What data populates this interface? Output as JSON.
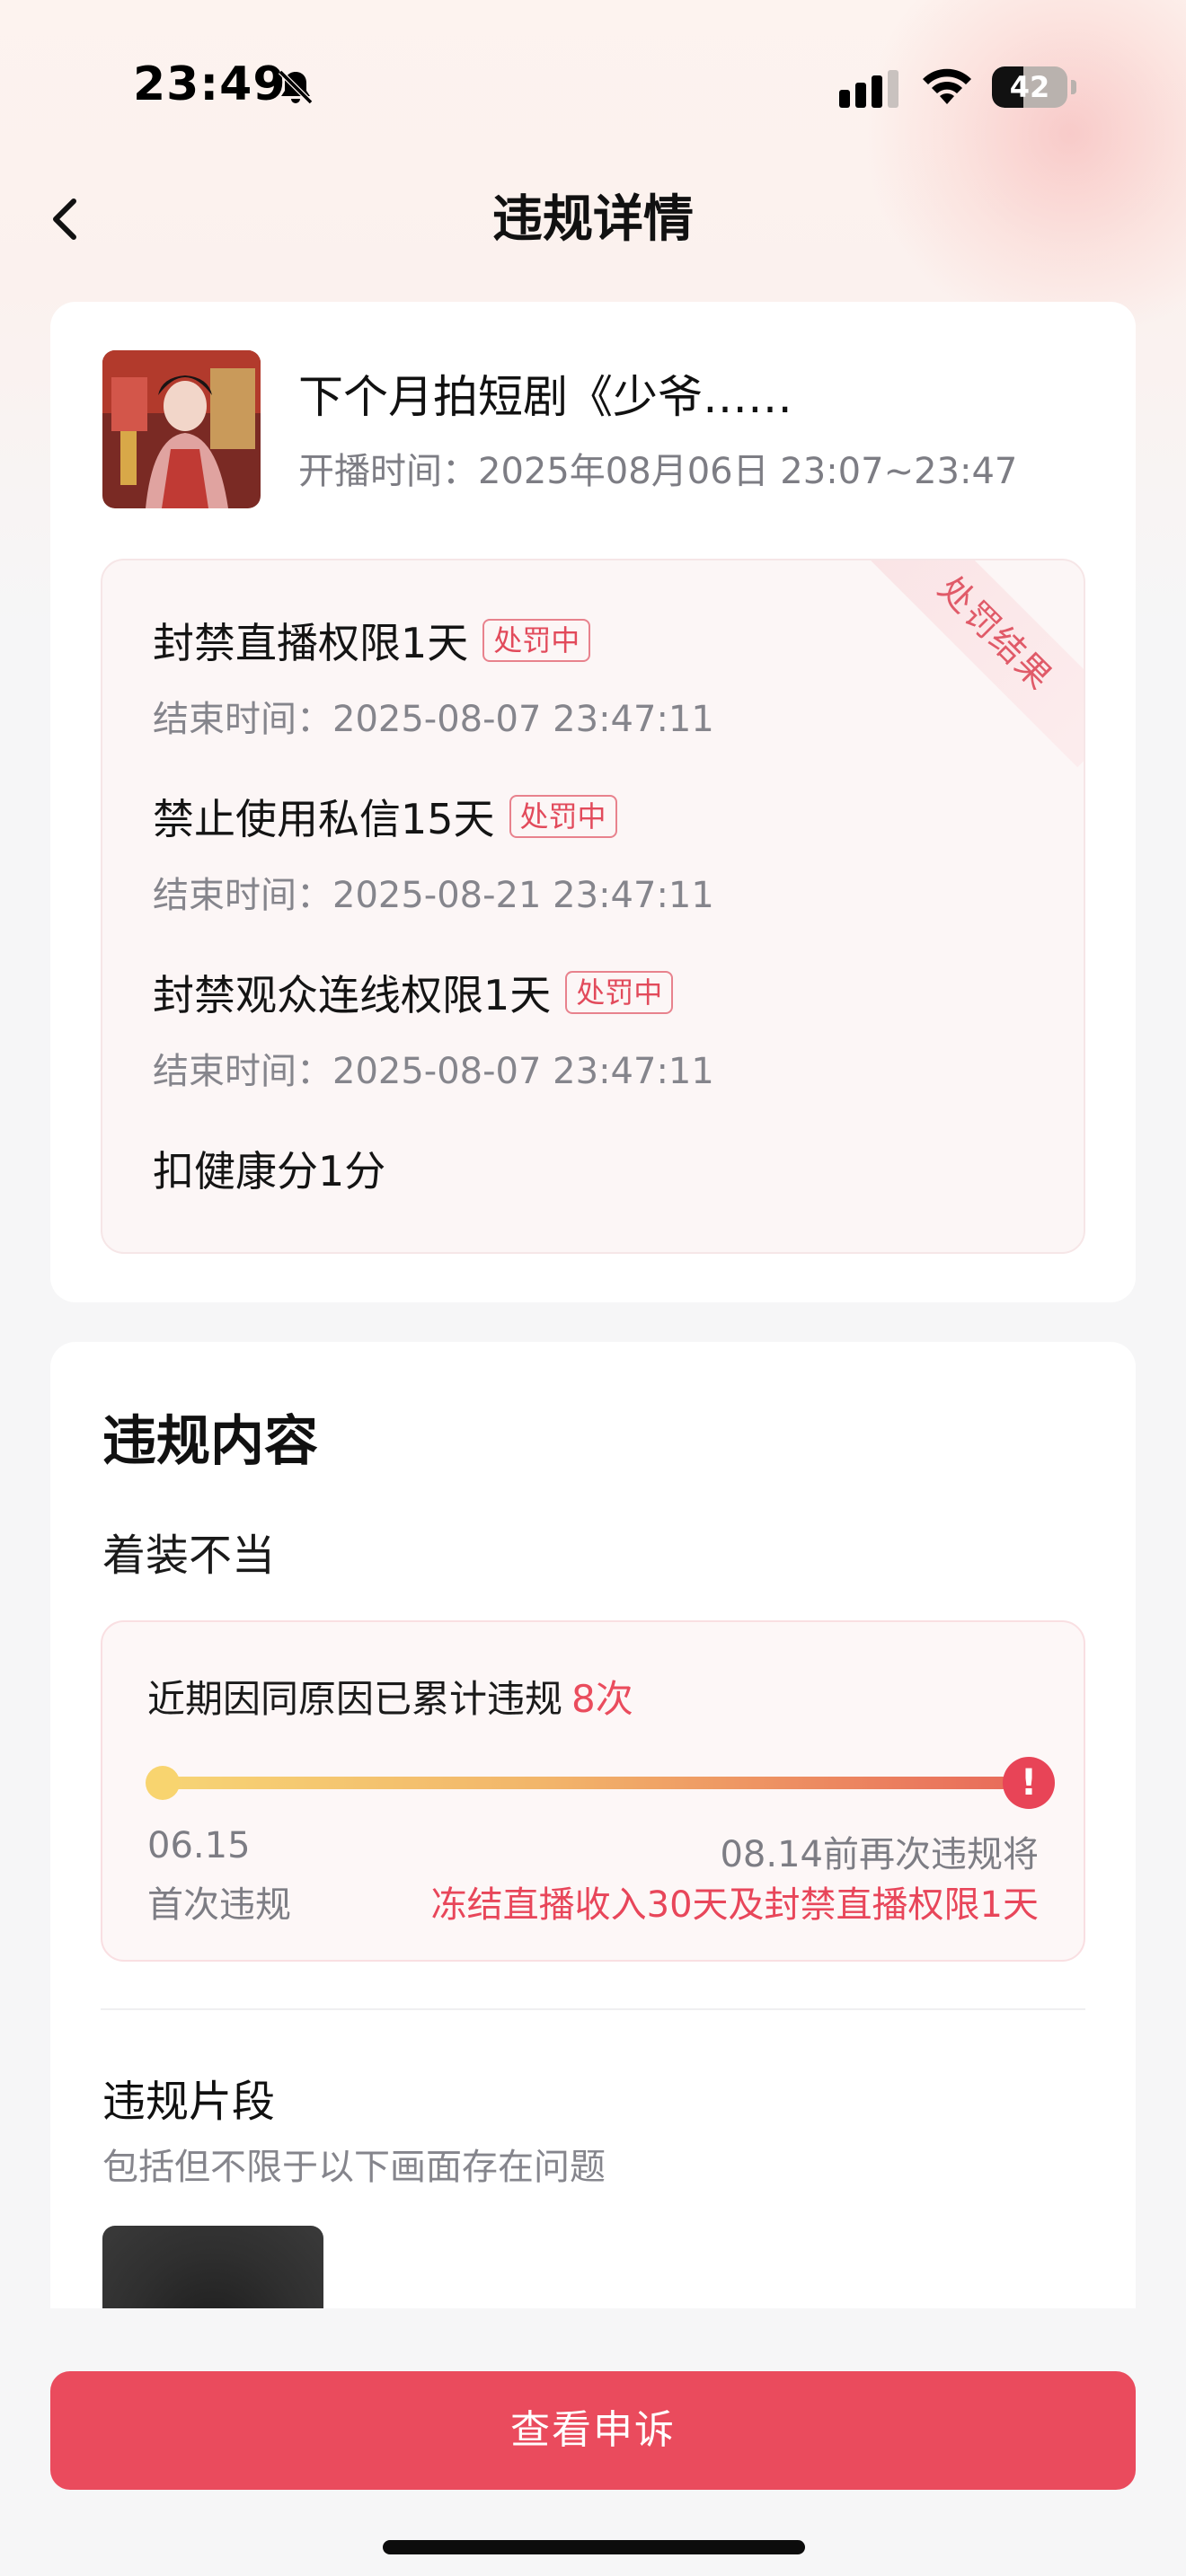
{
  "status_bar": {
    "time": "23:49",
    "battery": "42",
    "battery_level": 0.42
  },
  "nav": {
    "title": "违规详情"
  },
  "stream": {
    "title": "下个月拍短剧《少爷……",
    "time": "开播时间：2025年08月06日 23:07~23:47"
  },
  "penalty": {
    "ribbon": "处罚结果",
    "items": [
      {
        "name": "封禁直播权限1天",
        "tag": "处罚中",
        "end": "结束时间：2025-08-07 23:47:11"
      },
      {
        "name": "禁止使用私信15天",
        "tag": "处罚中",
        "end": "结束时间：2025-08-21 23:47:11"
      },
      {
        "name": "封禁观众连线权限1天",
        "tag": "处罚中",
        "end": "结束时间：2025-08-07 23:47:11"
      }
    ],
    "extra": "扣健康分1分"
  },
  "violation": {
    "section_title": "违规内容",
    "type": "着装不当",
    "count_label": "近期因同原因已累计违规",
    "count_value": "8次",
    "start_date": "06.15",
    "start_label": "首次违规",
    "end_date": "08.14前再次违规将",
    "end_label": "冻结直播收入30天及封禁直播权限1天",
    "end_icon": "!",
    "clip_title": "违规片段",
    "clip_desc": "包括但不限于以下画面存在问题"
  },
  "footer": {
    "appeal_label": "查看申诉"
  },
  "colors": {
    "accent": "#ea4b5d",
    "tag": "#e24a5b"
  }
}
